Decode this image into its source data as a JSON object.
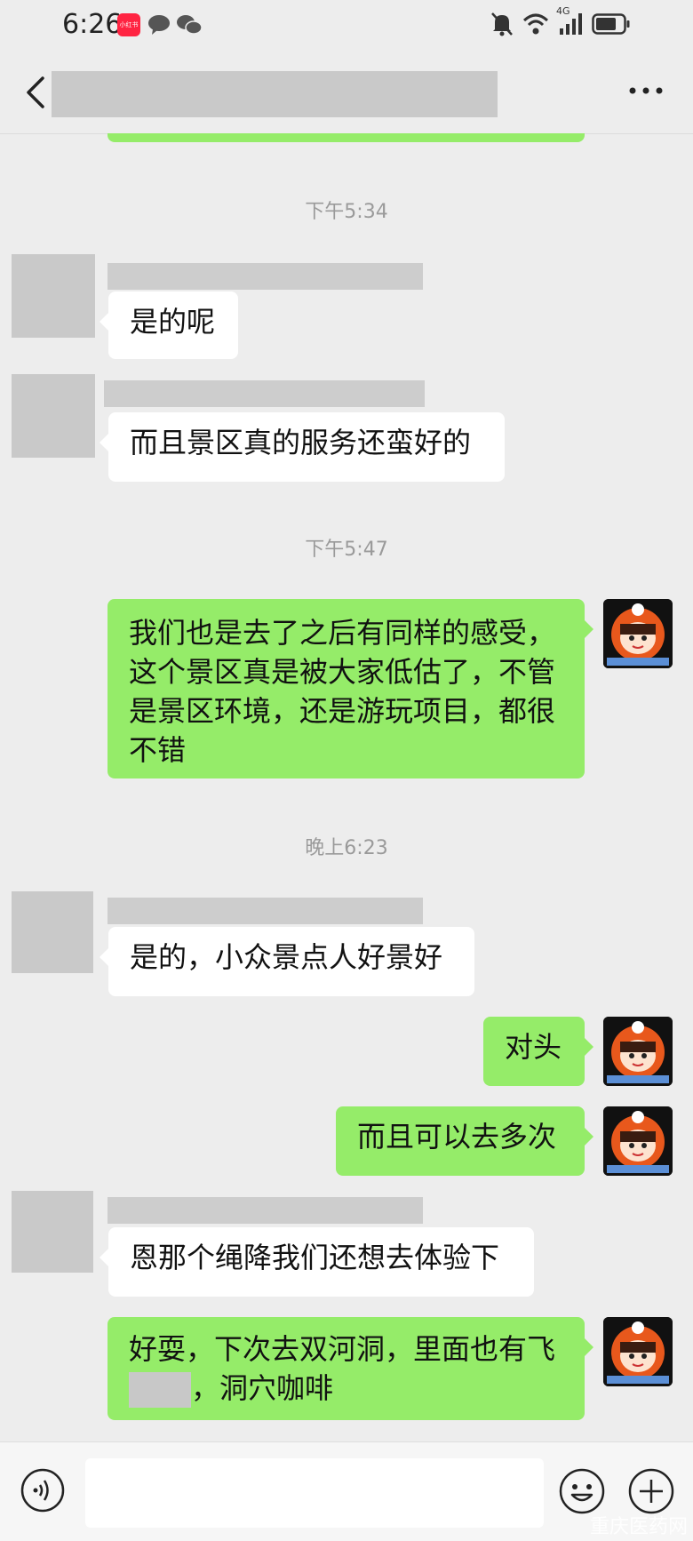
{
  "status_bar": {
    "time": "6:26",
    "app_badge_text": "小红书",
    "signal_label": "4G"
  },
  "header": {
    "back_icon": "chevron-left-icon",
    "more_icon": "ellipsis-icon"
  },
  "timestamps": [
    "下午5:34",
    "下午5:47",
    "晚上6:23"
  ],
  "messages": [
    {
      "side": "left",
      "text": "是的呢"
    },
    {
      "side": "left",
      "text": "而且景区真的服务还蛮好的"
    },
    {
      "side": "right",
      "line1": "我们也是去了之后有同样的感受，",
      "line2": "这个景区真是被大家低估了，不管",
      "line3": "是景区环境，还是游玩项目，都很",
      "line4": "不错"
    },
    {
      "side": "left",
      "text": "是的，小众景点人好景好"
    },
    {
      "side": "right",
      "text": "对头"
    },
    {
      "side": "right",
      "text": "而且可以去多次"
    },
    {
      "side": "left",
      "text": "恩那个绳降我们还想去体验下"
    },
    {
      "side": "right",
      "line1": "好耍，下次去双河洞，里面也有飞",
      "line2_tail": "，洞穴咖啡"
    }
  ],
  "input_bar": {
    "voice_icon": "voice-icon",
    "emoji_icon": "emoji-icon",
    "plus_icon": "plus-icon"
  },
  "watermark": "重庆医药网",
  "colors": {
    "background": "#ededed",
    "sent_bubble": "#95ec69",
    "received_bubble": "#ffffff",
    "timestamp": "#9a9a9a"
  }
}
